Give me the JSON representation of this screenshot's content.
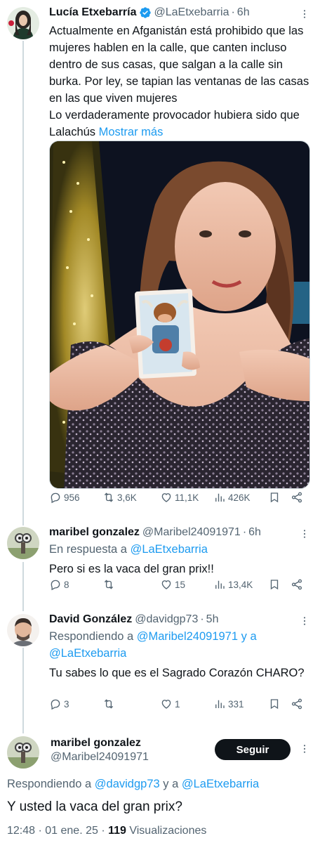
{
  "tweets": [
    {
      "name": "Lucía Etxebarría",
      "handle": "@LaEtxebarria",
      "time": "6h",
      "text": "Actualmente en Afganistán está prohibido que las mujeres hablen en la calle, que canten incluso dentro de sus casas, que salgan a la calle sin burka. Por ley, se tapian las ventanas de las casas en las que viven mujeres\nLo verdaderamente provocador hubiera sido que Lalachús ",
      "show_more": "Mostrar más",
      "stats": {
        "replies": "956",
        "reposts": "3,6K",
        "likes": "11,1K",
        "views": "426K"
      }
    },
    {
      "name": "maribel gonzalez",
      "handle": "@Maribel24091971",
      "time": "6h",
      "reply_prefix": "En respuesta a ",
      "reply_to": "@LaEtxebarria",
      "text": "Pero si es la vaca del gran prix!!",
      "stats": {
        "replies": "8",
        "reposts": "",
        "likes": "15",
        "views": "13,4K"
      }
    },
    {
      "name": "David González",
      "handle": "@davidgp73",
      "time": "5h",
      "reply_prefix": "Respondiendo a ",
      "reply_to": "@Maribel24091971 y a @LaEtxebarria",
      "text": "Tu sabes lo que es el Sagrado Corazón CHARO?",
      "stats": {
        "replies": "3",
        "reposts": "",
        "likes": "1",
        "views": "331"
      }
    }
  ],
  "main": {
    "name": "maribel gonzalez",
    "handle": "@Maribel24091971",
    "follow_label": "Seguir",
    "reply_prefix": "Respondiendo a ",
    "reply_to_1": "@davidgp73",
    "reply_mid": " y a ",
    "reply_to_2": "@LaEtxebarria",
    "text": "Y usted la vaca del gran prix?",
    "timestamp": "12:48 · 01 ene. 25 · ",
    "views_count": "119",
    "views_label": " Visualizaciones"
  },
  "colors": {
    "link": "#1d9bf0",
    "muted": "#536471",
    "text": "#0f1419",
    "line": "#cfd9de"
  }
}
